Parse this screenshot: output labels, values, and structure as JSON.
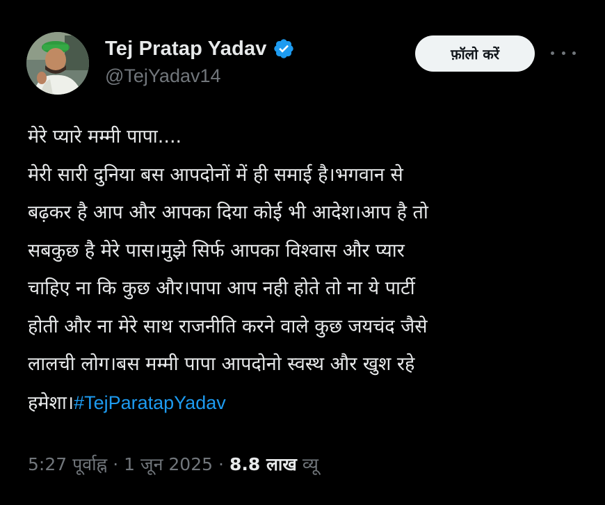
{
  "author": {
    "display_name": "Tej Pratap Yadav",
    "handle": "@TejYadav14",
    "avatar_icon": "profile-avatar",
    "verified_icon": "verified-badge-icon",
    "verified_color": "#1d9bf0"
  },
  "actions": {
    "follow_label": "फ़ॉलो करें",
    "more_icon": "more-options-icon"
  },
  "tweet": {
    "text": "मेरे प्यारे मम्मी पापा....\nमेरी सारी दुनिया बस आपदोनों में ही समाई है।भगवान से\nबढ़कर है आप और आपका दिया कोई भी आदेश।आप है तो\nसबकुछ है मेरे पास।मुझे सिर्फ आपका विश्वास और प्यार\nचाहिए ना कि कुछ और।पापा आप नही होते तो ना ये पार्टी\nहोती और ना मेरे साथ राजनीति करने वाले कुछ जयचंद जैसे\nलालची लोग।बस मम्मी पापा आपदोनो स्वस्थ और खुश रहे\nहमेशा।",
    "hashtag": "#TejParatapYadav",
    "hashtag_color": "#1d9bf0"
  },
  "meta": {
    "time": "5:27 पूर्वाह्न",
    "date": "1 जून 2025",
    "separator": "·",
    "views_count": "8.8 लाख",
    "views_label": "व्यू"
  }
}
